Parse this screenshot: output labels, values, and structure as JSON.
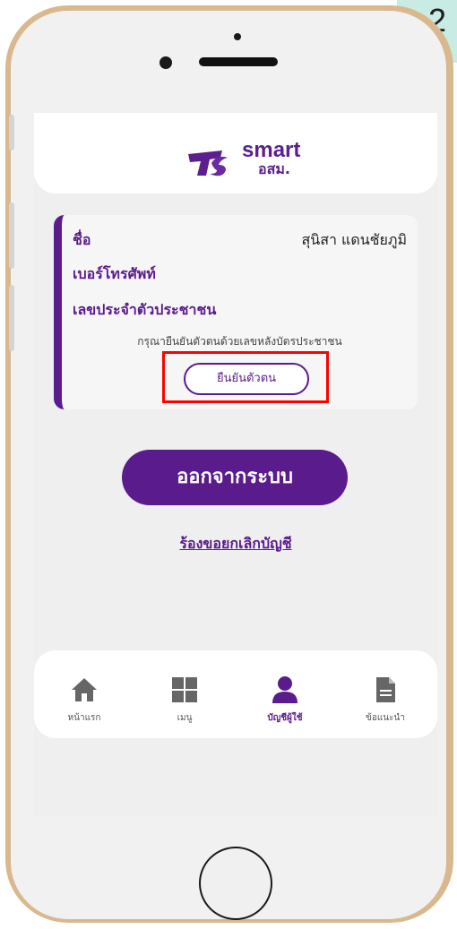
{
  "step": "2",
  "app": {
    "logo_text": "smart",
    "logo_sub": "อสม."
  },
  "profile": {
    "name_label": "ชื่อ",
    "name_value": "สุนิสา แดนชัยภูมิ",
    "phone_label": "เบอร์โทรศัพท์",
    "id_label": "เลขประจำตัวประชาชน",
    "verify_hint": "กรุณายืนยันตัวตนด้วยเลขหลังบัตรประชาชน",
    "verify_button": "ยืนยันตัวตน"
  },
  "actions": {
    "logout_button": "ออกจากระบบ",
    "cancel_account_link": "ร้องขอยกเลิกบัญชี"
  },
  "nav": {
    "items": [
      {
        "label": "หน้าแรก",
        "icon": "home-icon"
      },
      {
        "label": "เมนู",
        "icon": "grid-icon"
      },
      {
        "label": "บัญชีผู้ใช้",
        "icon": "user-icon",
        "active": true
      },
      {
        "label": "ข้อแนะนำ",
        "icon": "document-icon"
      }
    ]
  },
  "colors": {
    "primary": "#5a1b8d",
    "highlight": "#ff0000",
    "badge": "#c8ebe3"
  }
}
